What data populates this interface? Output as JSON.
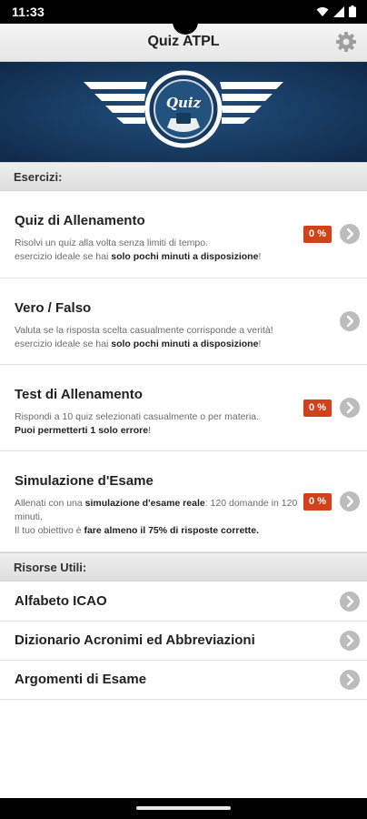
{
  "status_bar": {
    "time": "11:33"
  },
  "app_bar": {
    "title": "Quiz ATPL",
    "settings_icon": "gear-icon"
  },
  "banner": {
    "logo_text": "Quiz",
    "background": "#173a60"
  },
  "exercises_section": {
    "header": "Esercizi:",
    "items": [
      {
        "title": "Quiz di Allenamento",
        "desc_1": "Risolvi un quiz alla volta senza limiti di tempo.",
        "desc_2": "esercizio ideale se hai ",
        "desc_2_bold": "solo pochi minuti a disposizione",
        "desc_2_end": "!",
        "badge": "0 %"
      },
      {
        "title": "Vero / Falso",
        "desc_1": "Valuta se la risposta scelta casualmente corrisponde a verità!",
        "desc_2": "esercizio ideale se hai ",
        "desc_2_bold": "solo pochi minuti a disposizione",
        "desc_2_end": "!"
      },
      {
        "title": "Test di Allenamento",
        "desc_1": "Rispondi a 10 quiz selezionati casualmente o per materia.",
        "desc_2_bold": "Puoi permetterti 1 solo errore",
        "desc_2_end": "!",
        "badge": "0 %"
      },
      {
        "title": "Simulazione d'Esame",
        "desc_1": "Allenati con una ",
        "desc_1_bold": "simulazione d'esame reale",
        "desc_1_end": ": 120 domande in 120 minuti.",
        "desc_2": "Il tuo obiettivo è ",
        "desc_2_bold": "fare almeno il 75% di risposte corrette.",
        "badge": "0 %"
      }
    ]
  },
  "resources_section": {
    "header": "Risorse Utili:",
    "items": [
      {
        "label": "Alfabeto ICAO"
      },
      {
        "label": "Dizionario Acronimi ed Abbreviazioni"
      },
      {
        "label": "Argomenti di Esame"
      }
    ]
  },
  "colors": {
    "badge": "#d2421a",
    "chevron": "#bcbcbc",
    "banner": "#173a60"
  }
}
